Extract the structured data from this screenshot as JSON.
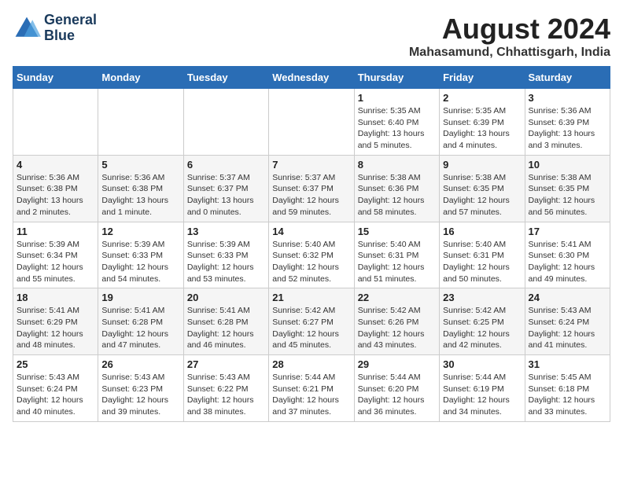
{
  "header": {
    "logo_line1": "General",
    "logo_line2": "Blue",
    "main_title": "August 2024",
    "sub_title": "Mahasamund, Chhattisgarh, India"
  },
  "weekdays": [
    "Sunday",
    "Monday",
    "Tuesday",
    "Wednesday",
    "Thursday",
    "Friday",
    "Saturday"
  ],
  "weeks": [
    [
      {
        "day": "",
        "info": ""
      },
      {
        "day": "",
        "info": ""
      },
      {
        "day": "",
        "info": ""
      },
      {
        "day": "",
        "info": ""
      },
      {
        "day": "1",
        "info": "Sunrise: 5:35 AM\nSunset: 6:40 PM\nDaylight: 13 hours\nand 5 minutes."
      },
      {
        "day": "2",
        "info": "Sunrise: 5:35 AM\nSunset: 6:39 PM\nDaylight: 13 hours\nand 4 minutes."
      },
      {
        "day": "3",
        "info": "Sunrise: 5:36 AM\nSunset: 6:39 PM\nDaylight: 13 hours\nand 3 minutes."
      }
    ],
    [
      {
        "day": "4",
        "info": "Sunrise: 5:36 AM\nSunset: 6:38 PM\nDaylight: 13 hours\nand 2 minutes."
      },
      {
        "day": "5",
        "info": "Sunrise: 5:36 AM\nSunset: 6:38 PM\nDaylight: 13 hours\nand 1 minute."
      },
      {
        "day": "6",
        "info": "Sunrise: 5:37 AM\nSunset: 6:37 PM\nDaylight: 13 hours\nand 0 minutes."
      },
      {
        "day": "7",
        "info": "Sunrise: 5:37 AM\nSunset: 6:37 PM\nDaylight: 12 hours\nand 59 minutes."
      },
      {
        "day": "8",
        "info": "Sunrise: 5:38 AM\nSunset: 6:36 PM\nDaylight: 12 hours\nand 58 minutes."
      },
      {
        "day": "9",
        "info": "Sunrise: 5:38 AM\nSunset: 6:35 PM\nDaylight: 12 hours\nand 57 minutes."
      },
      {
        "day": "10",
        "info": "Sunrise: 5:38 AM\nSunset: 6:35 PM\nDaylight: 12 hours\nand 56 minutes."
      }
    ],
    [
      {
        "day": "11",
        "info": "Sunrise: 5:39 AM\nSunset: 6:34 PM\nDaylight: 12 hours\nand 55 minutes."
      },
      {
        "day": "12",
        "info": "Sunrise: 5:39 AM\nSunset: 6:33 PM\nDaylight: 12 hours\nand 54 minutes."
      },
      {
        "day": "13",
        "info": "Sunrise: 5:39 AM\nSunset: 6:33 PM\nDaylight: 12 hours\nand 53 minutes."
      },
      {
        "day": "14",
        "info": "Sunrise: 5:40 AM\nSunset: 6:32 PM\nDaylight: 12 hours\nand 52 minutes."
      },
      {
        "day": "15",
        "info": "Sunrise: 5:40 AM\nSunset: 6:31 PM\nDaylight: 12 hours\nand 51 minutes."
      },
      {
        "day": "16",
        "info": "Sunrise: 5:40 AM\nSunset: 6:31 PM\nDaylight: 12 hours\nand 50 minutes."
      },
      {
        "day": "17",
        "info": "Sunrise: 5:41 AM\nSunset: 6:30 PM\nDaylight: 12 hours\nand 49 minutes."
      }
    ],
    [
      {
        "day": "18",
        "info": "Sunrise: 5:41 AM\nSunset: 6:29 PM\nDaylight: 12 hours\nand 48 minutes."
      },
      {
        "day": "19",
        "info": "Sunrise: 5:41 AM\nSunset: 6:28 PM\nDaylight: 12 hours\nand 47 minutes."
      },
      {
        "day": "20",
        "info": "Sunrise: 5:41 AM\nSunset: 6:28 PM\nDaylight: 12 hours\nand 46 minutes."
      },
      {
        "day": "21",
        "info": "Sunrise: 5:42 AM\nSunset: 6:27 PM\nDaylight: 12 hours\nand 45 minutes."
      },
      {
        "day": "22",
        "info": "Sunrise: 5:42 AM\nSunset: 6:26 PM\nDaylight: 12 hours\nand 43 minutes."
      },
      {
        "day": "23",
        "info": "Sunrise: 5:42 AM\nSunset: 6:25 PM\nDaylight: 12 hours\nand 42 minutes."
      },
      {
        "day": "24",
        "info": "Sunrise: 5:43 AM\nSunset: 6:24 PM\nDaylight: 12 hours\nand 41 minutes."
      }
    ],
    [
      {
        "day": "25",
        "info": "Sunrise: 5:43 AM\nSunset: 6:24 PM\nDaylight: 12 hours\nand 40 minutes."
      },
      {
        "day": "26",
        "info": "Sunrise: 5:43 AM\nSunset: 6:23 PM\nDaylight: 12 hours\nand 39 minutes."
      },
      {
        "day": "27",
        "info": "Sunrise: 5:43 AM\nSunset: 6:22 PM\nDaylight: 12 hours\nand 38 minutes."
      },
      {
        "day": "28",
        "info": "Sunrise: 5:44 AM\nSunset: 6:21 PM\nDaylight: 12 hours\nand 37 minutes."
      },
      {
        "day": "29",
        "info": "Sunrise: 5:44 AM\nSunset: 6:20 PM\nDaylight: 12 hours\nand 36 minutes."
      },
      {
        "day": "30",
        "info": "Sunrise: 5:44 AM\nSunset: 6:19 PM\nDaylight: 12 hours\nand 34 minutes."
      },
      {
        "day": "31",
        "info": "Sunrise: 5:45 AM\nSunset: 6:18 PM\nDaylight: 12 hours\nand 33 minutes."
      }
    ]
  ]
}
